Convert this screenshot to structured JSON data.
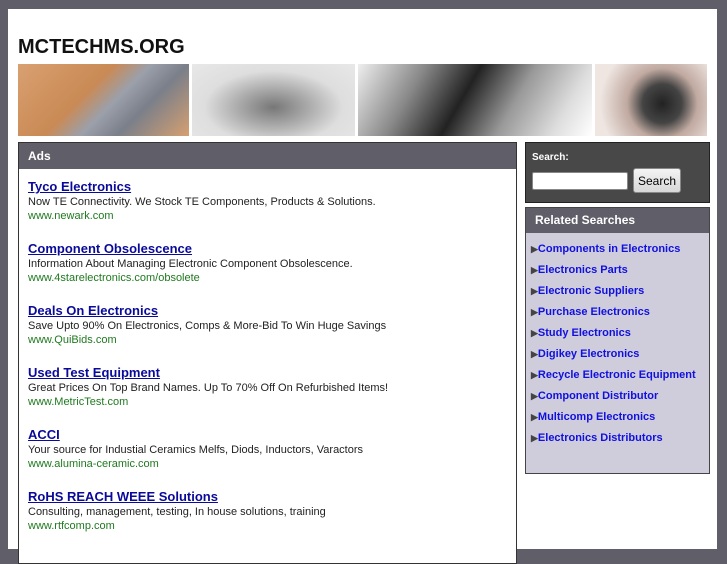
{
  "site_title": "MCTECHMS.ORG",
  "ads": {
    "heading": "Ads",
    "items": [
      {
        "title": "Tyco Electronics",
        "desc": "Now TE Connectivity. We Stock TE Components, Products & Solutions.",
        "url": "www.newark.com"
      },
      {
        "title": "Component Obsolescence",
        "desc": "Information About Managing Electronic Component Obsolescence.",
        "url": "www.4starelectronics.com/obsolete"
      },
      {
        "title": "Deals On Electronics",
        "desc": "Save Upto 90% On Electronics, Comps & More-Bid To Win Huge Savings",
        "url": "www.QuiBids.com"
      },
      {
        "title": "Used Test Equipment",
        "desc": "Great Prices On Top Brand Names. Up To 70% Off On Refurbished Items!",
        "url": "www.MetricTest.com"
      },
      {
        "title": "ACCI",
        "desc": "Your source for Industial Ceramics Melfs, Diods, Inductors, Varactors",
        "url": "www.alumina-ceramic.com"
      },
      {
        "title": "RoHS REACH WEEE Solutions",
        "desc": "Consulting, management, testing, In house solutions, training",
        "url": "www.rtfcomp.com"
      }
    ]
  },
  "search": {
    "label": "Search:",
    "value": "",
    "button": "Search"
  },
  "related": {
    "heading": "Related Searches",
    "items": [
      "Components in Electronics",
      "Electronics Parts",
      "Electronic Suppliers",
      "Purchase Electronics",
      "Study Electronics",
      "Digikey Electronics",
      "Recycle Electronic Equipment",
      "Component Distributor",
      "Multicomp Electronics",
      "Electronics Distributors"
    ]
  }
}
